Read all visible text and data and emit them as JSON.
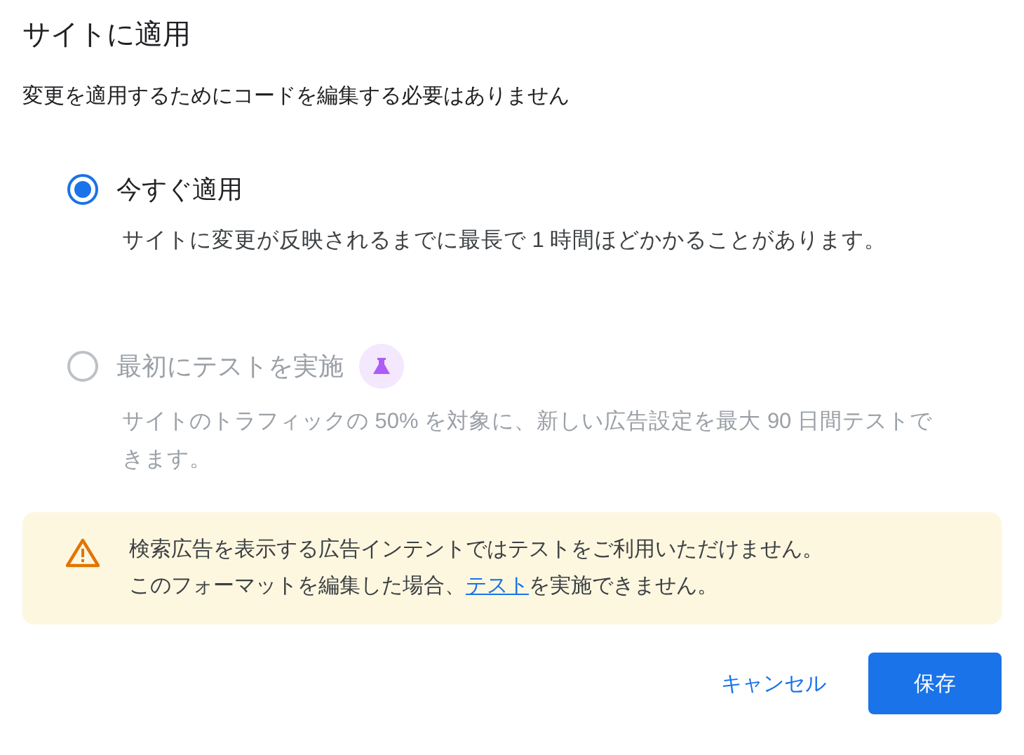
{
  "dialog": {
    "title": "サイトに適用",
    "subtitle": "変更を適用するためにコードを編集する必要はありません"
  },
  "options": [
    {
      "label": "今すぐ適用",
      "description": "サイトに変更が反映されるまでに最長で 1 時間ほどかかることがあります。",
      "selected": true,
      "disabled": false,
      "badge": false
    },
    {
      "label": "最初にテストを実施",
      "description": "サイトのトラフィックの 50% を対象に、新しい広告設定を最大 90 日間テストできます。",
      "selected": false,
      "disabled": true,
      "badge": true
    }
  ],
  "notice": {
    "line_1": "検索広告を表示する広告インテントではテストをご利用いただけません。",
    "line_2_before_link": "このフォーマットを編集した場合、",
    "link": "テスト",
    "line_2_after_link": "を実施できません。"
  },
  "buttons": {
    "cancel": "キャンセル",
    "save": "保存"
  }
}
